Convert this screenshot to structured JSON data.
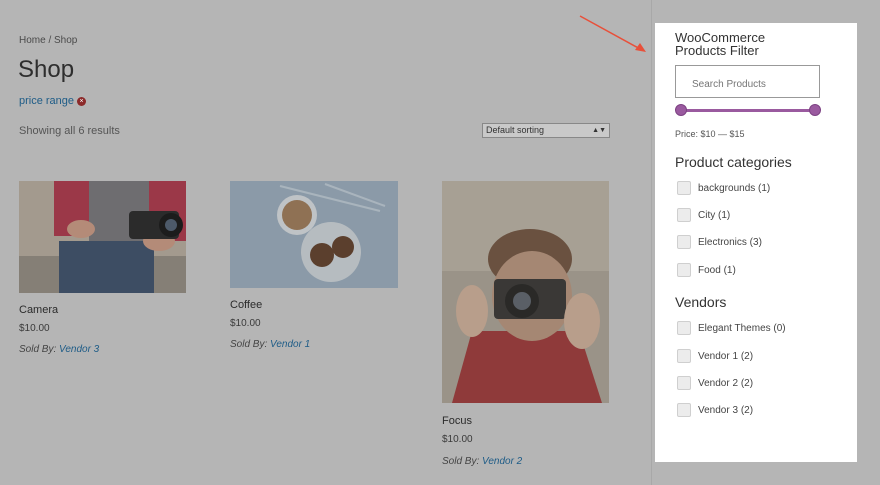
{
  "breadcrumb": "Home / Shop",
  "page_title": "Shop",
  "active_filter": {
    "label": "price range",
    "remove_icon": "close-circle-icon"
  },
  "results_text": "Showing all 6 results",
  "sorting": {
    "selected": "Default sorting"
  },
  "products": [
    {
      "name": "Camera",
      "price": "$10.00",
      "sold_by_label": "Sold By:",
      "vendor": "Vendor 3"
    },
    {
      "name": "Coffee",
      "price": "$10.00",
      "sold_by_label": "Sold By:",
      "vendor": "Vendor 1"
    },
    {
      "name": "Focus",
      "price": "$10.00",
      "sold_by_label": "Sold By:",
      "vendor": "Vendor 2"
    }
  ],
  "widget": {
    "title": "WooCommerce Products Filter",
    "search_placeholder": "Search Products",
    "price_label": "Price: $10 — $15",
    "categories_title": "Product categories",
    "categories": [
      {
        "label": "backgrounds (1)"
      },
      {
        "label": "City (1)"
      },
      {
        "label": "Electronics (3)"
      },
      {
        "label": "Food (1)"
      }
    ],
    "vendors_title": "Vendors",
    "vendors": [
      {
        "label": "Elegant Themes (0)"
      },
      {
        "label": "Vendor 1 (2)"
      },
      {
        "label": "Vendor 2 (2)"
      },
      {
        "label": "Vendor 3 (2)"
      }
    ]
  },
  "colors": {
    "slider": "#9a5a9f",
    "link": "#1e5c87",
    "arrow": "#e8503a"
  }
}
